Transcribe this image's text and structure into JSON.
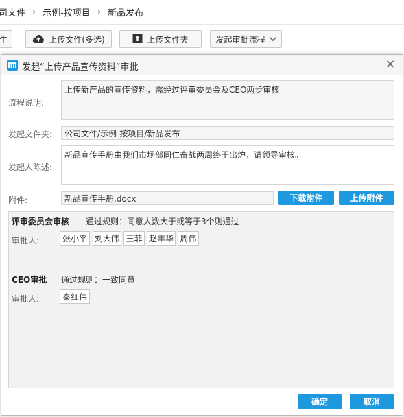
{
  "breadcrumb": {
    "items": [
      "司文件",
      "示例-按项目",
      "新品发布"
    ],
    "separator": "›"
  },
  "toolbar": {
    "partial_button_label": "生",
    "upload_files_label": "上传文件(多选)",
    "upload_folder_label": "上传文件夹",
    "start_flow_label": "发起审批流程"
  },
  "dialog": {
    "title": "发起“上传产品宣传资料”审批",
    "close_symbol": "×",
    "flow_desc_label": "流程说明:",
    "flow_desc_value": "上传新产品的宣传资料，需经过评审委员会及CEO两步审核",
    "folder_label": "发起文件夹:",
    "folder_value": "公司文件/示例-按项目/新品发布",
    "statement_label": "发起人陈述:",
    "statement_value": "新品宣传手册由我们市场部同仁奋战两周终于出炉，请领导审核。",
    "attach_label": "附件:",
    "attach_value": "新品宣传手册.docx",
    "download_attach_label": "下载附件",
    "upload_attach_label": "上传附件",
    "steps": [
      {
        "title": "评审委员会审核",
        "rule": "通过规则：同意人数大于或等于3个则通过",
        "approver_label": "审批人:",
        "approvers": [
          "张小平",
          "刘大伟",
          "王菲",
          "赵丰华",
          "周伟"
        ]
      },
      {
        "title": "CEO审批",
        "rule": "通过规则：一致同意",
        "approver_label": "审批人:",
        "approvers": [
          "秦红伟"
        ]
      }
    ],
    "confirm_label": "确定",
    "cancel_label": "取消"
  },
  "colors": {
    "accent_blue": "#1e98de",
    "field_bg": "#f5f5f5",
    "panel_bg": "#f2f2f2"
  }
}
